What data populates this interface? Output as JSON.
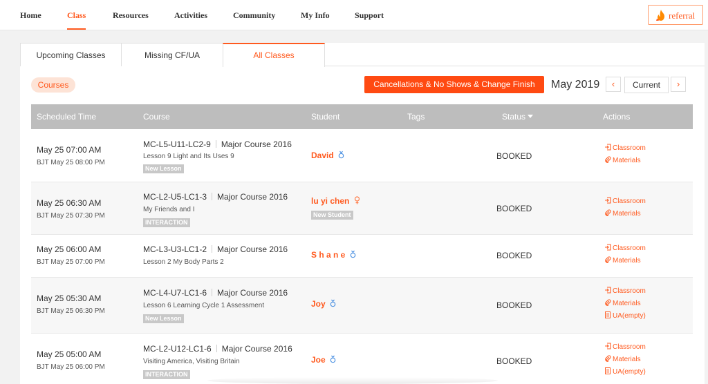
{
  "nav": {
    "items": [
      "Home",
      "Class",
      "Resources",
      "Activities",
      "Community",
      "My Info",
      "Support"
    ],
    "active": "Class",
    "referral_label": "referral"
  },
  "tabs": [
    "Upcoming Classes",
    "Missing CF/UA",
    "All Classes"
  ],
  "active_tab": "All Classes",
  "toolbar": {
    "courses_label": "Courses",
    "cancel_label": "Cancellations & No Shows & Change Finish Type",
    "month": "May 2019",
    "prev_label": "‹",
    "next_label": "›",
    "current_label": "Current"
  },
  "table": {
    "headers": [
      "Scheduled Time",
      "Course",
      "Student",
      "Tags",
      "Status",
      "Actions"
    ],
    "rows": [
      {
        "time": "May 25 07:00 AM",
        "bjt": "BJT May 25 08:00 PM",
        "code": "MC-L5-U11-LC2-9",
        "course": "Major Course 2016",
        "desc": "Lesson 9 Light and Its Uses 9",
        "badge": "New Lesson",
        "student": "David",
        "gender": "male",
        "student_badge": "",
        "status": "BOOKED",
        "actions": [
          "Classroom",
          "Materials"
        ]
      },
      {
        "time": "May 25 06:30 AM",
        "bjt": "BJT May 25 07:30 PM",
        "code": "MC-L2-U5-LC1-3",
        "course": "Major Course 2016",
        "desc": "My Friends and I",
        "badge": "INTERACTION",
        "student": "lu yi chen",
        "gender": "female",
        "student_badge": "New Student",
        "status": "BOOKED",
        "actions": [
          "Classroom",
          "Materials"
        ]
      },
      {
        "time": "May 25 06:00 AM",
        "bjt": "BJT May 25 07:00 PM",
        "code": "MC-L3-U3-LC1-2",
        "course": "Major Course 2016",
        "desc": "Lesson 2 My Body Parts 2",
        "badge": "",
        "student": "S h a n e",
        "gender": "male",
        "student_badge": "",
        "status": "BOOKED",
        "actions": [
          "Classroom",
          "Materials"
        ]
      },
      {
        "time": "May 25 05:30 AM",
        "bjt": "BJT May 25 06:30 PM",
        "code": "MC-L4-U7-LC1-6",
        "course": "Major Course 2016",
        "desc": "Lesson 6 Learning Cycle 1 Assessment",
        "badge": "New Lesson",
        "student": "Joy",
        "gender": "male",
        "student_badge": "",
        "status": "BOOKED",
        "actions": [
          "Classroom",
          "Materials",
          "UA(empty)"
        ]
      },
      {
        "time": "May 25 05:00 AM",
        "bjt": "BJT May 25 06:00 PM",
        "code": "MC-L2-U12-LC1-6",
        "course": "Major Course 2016",
        "desc": "Visiting America, Visiting Britain",
        "badge": "INTERACTION",
        "student": "Joe",
        "gender": "male",
        "student_badge": "",
        "status": "BOOKED",
        "actions": [
          "Classroom",
          "Materials",
          "UA(empty)"
        ]
      }
    ]
  },
  "colors": {
    "accent": "#ff5a1f",
    "header_bg": "#bdbdbd",
    "male": "#4a90e2",
    "female": "#ff7a45"
  }
}
